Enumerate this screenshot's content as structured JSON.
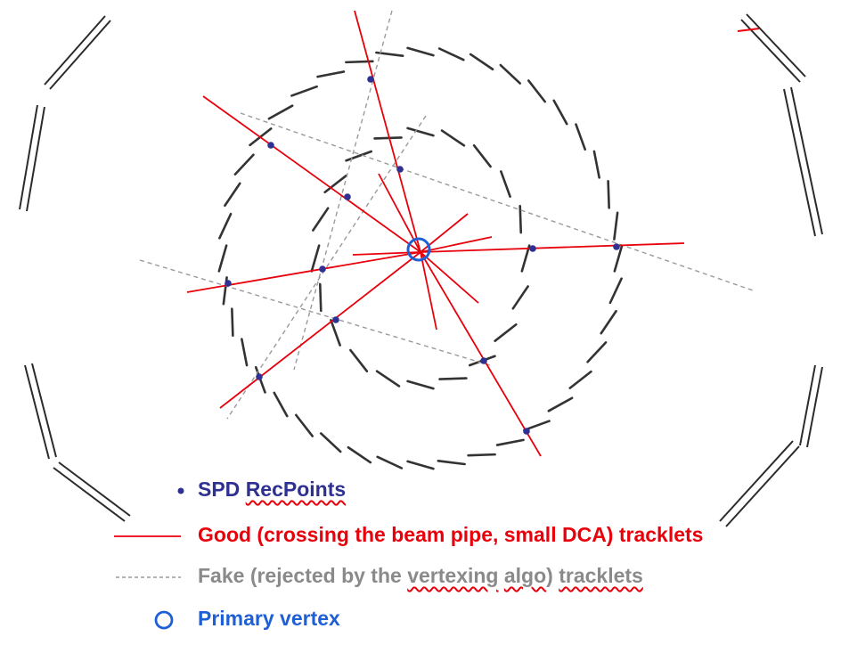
{
  "legend": {
    "rec_points": {
      "prefix": "SPD ",
      "word": "RecPoints"
    },
    "good": "Good (crossing the beam pipe, small DCA) tracklets",
    "fake": {
      "part1": "Fake (rejected by the ",
      "word1": "vertexing",
      "part2": " ",
      "word2": "algo",
      "part3": ") ",
      "word3": "tracklets"
    },
    "primary_vertex": "Primary vertex"
  },
  "colors": {
    "rec_point": "#2e3192",
    "good_tracklet": "#e8000b",
    "fake_tracklet": "#9a9a9a",
    "primary_vertex": "#1f5fd6",
    "detector": "#2b2b2b"
  }
}
